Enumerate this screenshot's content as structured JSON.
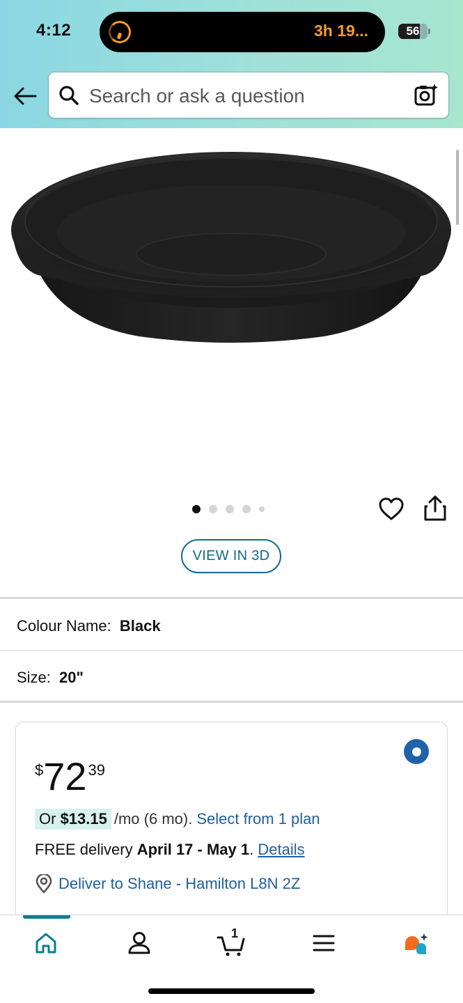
{
  "status_bar": {
    "time": "4:12",
    "activity_timer": "3h 19...",
    "battery": "56"
  },
  "header": {
    "search_placeholder": "Search or ask a question",
    "icons": [
      "back-arrow-icon",
      "search-icon",
      "camera-icon"
    ]
  },
  "gallery": {
    "image_count": 5,
    "active_index": 0,
    "view_3d_label": "VIEW IN 3D"
  },
  "variants": {
    "colour": {
      "label": "Colour Name:",
      "value": "Black"
    },
    "size": {
      "label": "Size:",
      "value": "20\""
    }
  },
  "buy_box": {
    "price_symbol": "$",
    "price_whole": "72",
    "price_fraction": "39",
    "monthly": {
      "prefix": "Or ",
      "amount": "$13.15",
      "suffix": "/mo (6 mo).",
      "plan_link": "Select from 1 plan"
    },
    "delivery": {
      "prefix": "FREE delivery ",
      "dates": "April 17 - May 1",
      "sep": ".",
      "details_link": "Details"
    },
    "deliver_to": "Deliver to Shane - Hamilton L8N 2Z"
  },
  "tab_bar": {
    "items": [
      "home",
      "account",
      "cart",
      "menu",
      "assistant"
    ],
    "active": "home",
    "cart_count": "1"
  },
  "colors": {
    "link": "#1f5fa0",
    "teal": "#0f7c90",
    "radio": "#1f62a8"
  }
}
